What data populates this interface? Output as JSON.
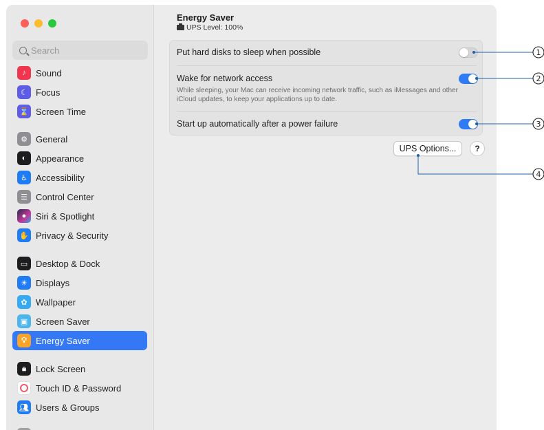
{
  "sidebar": {
    "search_placeholder": "Search",
    "items": [
      {
        "label": "Sound",
        "icon": "speaker-icon",
        "color": "#f0364f"
      },
      {
        "label": "Focus",
        "icon": "moon-icon",
        "color": "#5e5ce6"
      },
      {
        "label": "Screen Time",
        "icon": "hourglass-icon",
        "color": "#5e5ce6"
      },
      {
        "label": "General",
        "icon": "gear-icon",
        "color": "#8e8e93"
      },
      {
        "label": "Appearance",
        "icon": "appearance-icon",
        "color": "#1d1d1f"
      },
      {
        "label": "Accessibility",
        "icon": "accessibility-icon",
        "color": "#1f7cf4"
      },
      {
        "label": "Control Center",
        "icon": "control-center-icon",
        "color": "#8e8e93"
      },
      {
        "label": "Siri & Spotlight",
        "icon": "siri-icon",
        "color": "#2b2b4f"
      },
      {
        "label": "Privacy & Security",
        "icon": "hand-icon",
        "color": "#1f7cf4"
      },
      {
        "label": "Desktop & Dock",
        "icon": "dock-icon",
        "color": "#1d1d1f"
      },
      {
        "label": "Displays",
        "icon": "sun-icon",
        "color": "#1f7cf4"
      },
      {
        "label": "Wallpaper",
        "icon": "flower-icon",
        "color": "#35aaf2"
      },
      {
        "label": "Screen Saver",
        "icon": "screen-saver-icon",
        "color": "#4ab6ec"
      },
      {
        "label": "Energy Saver",
        "icon": "bulb-icon",
        "color": "#f7a428"
      },
      {
        "label": "Lock Screen",
        "icon": "lock-icon",
        "color": "#1d1d1f"
      },
      {
        "label": "Touch ID & Password",
        "icon": "fingerprint-icon",
        "color": "#f25c6a"
      },
      {
        "label": "Users & Groups",
        "icon": "users-icon",
        "color": "#1f7cf4"
      }
    ]
  },
  "header": {
    "title": "Energy Saver",
    "ups_level": "UPS Level: 100%"
  },
  "settings": [
    {
      "label": "Put hard disks to sleep when possible",
      "on": false
    },
    {
      "label": "Wake for network access",
      "description": "While sleeping, your Mac can receive incoming network traffic, such as iMessages and other iCloud updates, to keep your applications up to date.",
      "on": true
    },
    {
      "label": "Start up automatically after a power failure",
      "on": true
    }
  ],
  "buttons": {
    "ups_options": "UPS Options...",
    "help": "?"
  },
  "callouts": [
    "1",
    "2",
    "3",
    "4"
  ],
  "colors": {
    "accent": "#3478f6",
    "toggle_on": "#2f7bf5",
    "callout_line": "#1f5fa8"
  }
}
